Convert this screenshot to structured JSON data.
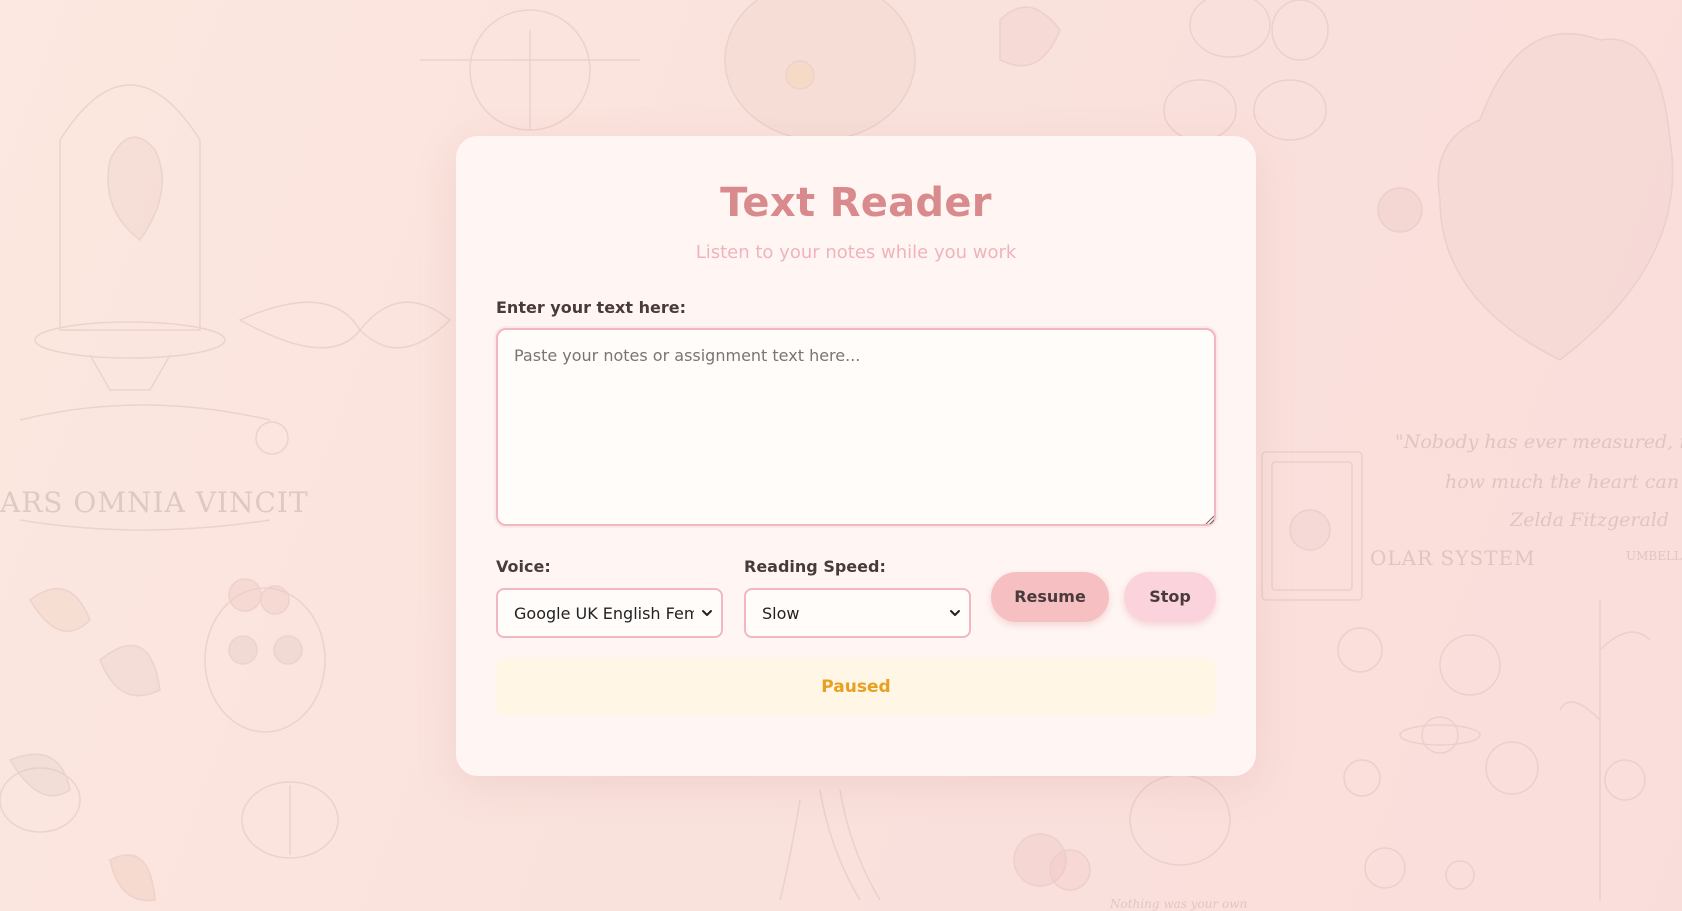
{
  "app": {
    "title": "Text Reader",
    "subtitle": "Listen to your notes while you work"
  },
  "text_input": {
    "label": "Enter your text here:",
    "placeholder": "Paste your notes or assignment text here...",
    "value": ""
  },
  "voice": {
    "label": "Voice:",
    "selected": "Google UK English Femal"
  },
  "speed": {
    "label": "Reading Speed:",
    "selected": "Slow"
  },
  "buttons": {
    "resume_label": "Resume",
    "stop_label": "Stop"
  },
  "status": {
    "text": "Paused"
  },
  "background": {
    "texts": [
      "ARS OMNIA VINCIT",
      "\"Nobody has ever measured, not even",
      "how much the heart can hold.\"",
      "Zelda Fitzgerald",
      "OLAR SYSTEM",
      "UMBELL",
      "Nothing was your own"
    ]
  },
  "colors": {
    "title": "#d98a8c",
    "subtitle": "#f0b3bb",
    "resume_button": "#f6c0c3",
    "stop_button": "#fbd3dc",
    "status_text": "#e8a020",
    "status_bg": "#fff6e6",
    "border": "#f2b8c1"
  }
}
